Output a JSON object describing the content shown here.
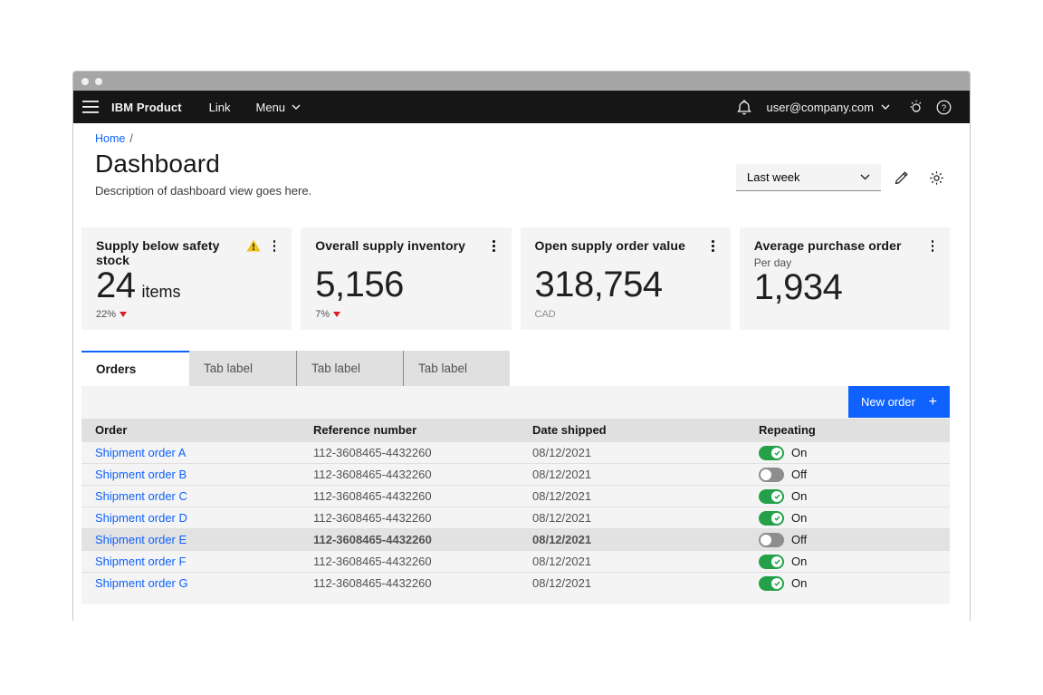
{
  "header": {
    "brand": "IBM Product",
    "links": [
      {
        "label": "Link"
      },
      {
        "label": "Menu"
      }
    ],
    "account": {
      "email": "user@company.com"
    }
  },
  "breadcrumb": {
    "home": "Home",
    "separator": "/"
  },
  "page_header": {
    "title": "Dashboard",
    "description": "Description of dashboard view goes here.",
    "filter": {
      "value": "Last week"
    }
  },
  "cards": [
    {
      "title": "Supply below safety stock",
      "value": "24",
      "suffix": "items",
      "trend": "22%",
      "trend_direction": "down",
      "has_warning": true
    },
    {
      "title": "Overall supply inventory",
      "value": "5,156",
      "trend": "7%",
      "trend_direction": "down"
    },
    {
      "title": "Open supply order value",
      "value": "318,754",
      "unit": "CAD"
    },
    {
      "title": "Average purchase order",
      "subtitle": "Per day",
      "value": "1,934"
    }
  ],
  "tabs": [
    {
      "label": "Orders",
      "active": true
    },
    {
      "label": "Tab label",
      "active": false
    },
    {
      "label": "Tab label",
      "active": false
    },
    {
      "label": "Tab label",
      "active": false
    }
  ],
  "orders": {
    "new_button": {
      "label": "New order",
      "icon": "+"
    },
    "columns": [
      "Order",
      "Reference number",
      "Date shipped",
      "Repeating"
    ],
    "rows": [
      {
        "order": "Shipment order A",
        "reference": "112-3608465-4432260",
        "date_shipped": "08/12/2021",
        "repeating": "On",
        "toggle_on": true,
        "hovered": false
      },
      {
        "order": "Shipment order B",
        "reference": "112-3608465-4432260",
        "date_shipped": "08/12/2021",
        "repeating": "Off",
        "toggle_on": false,
        "hovered": false
      },
      {
        "order": "Shipment order C",
        "reference": "112-3608465-4432260",
        "date_shipped": "08/12/2021",
        "repeating": "On",
        "toggle_on": true,
        "hovered": false
      },
      {
        "order": "Shipment order D",
        "reference": "112-3608465-4432260",
        "date_shipped": "08/12/2021",
        "repeating": "On",
        "toggle_on": true,
        "hovered": false
      },
      {
        "order": "Shipment order E",
        "reference": "112-3608465-4432260",
        "date_shipped": "08/12/2021",
        "repeating": "Off",
        "toggle_on": false,
        "hovered": true
      },
      {
        "order": "Shipment order F",
        "reference": "112-3608465-4432260",
        "date_shipped": "08/12/2021",
        "repeating": "On",
        "toggle_on": true,
        "hovered": false
      },
      {
        "order": "Shipment order G",
        "reference": "112-3608465-4432260",
        "date_shipped": "08/12/2021",
        "repeating": "On",
        "toggle_on": true,
        "hovered": false
      }
    ]
  },
  "colors": {
    "accent": "#0f62fe",
    "toggle_on": "#24a148",
    "toggle_off": "#8d8d8d",
    "warning": "#f1c21b",
    "trend_down": "#da1e28",
    "header_bg": "#161616",
    "card_bg": "#f4f4f4",
    "table_header_bg": "#e0e0e0"
  }
}
